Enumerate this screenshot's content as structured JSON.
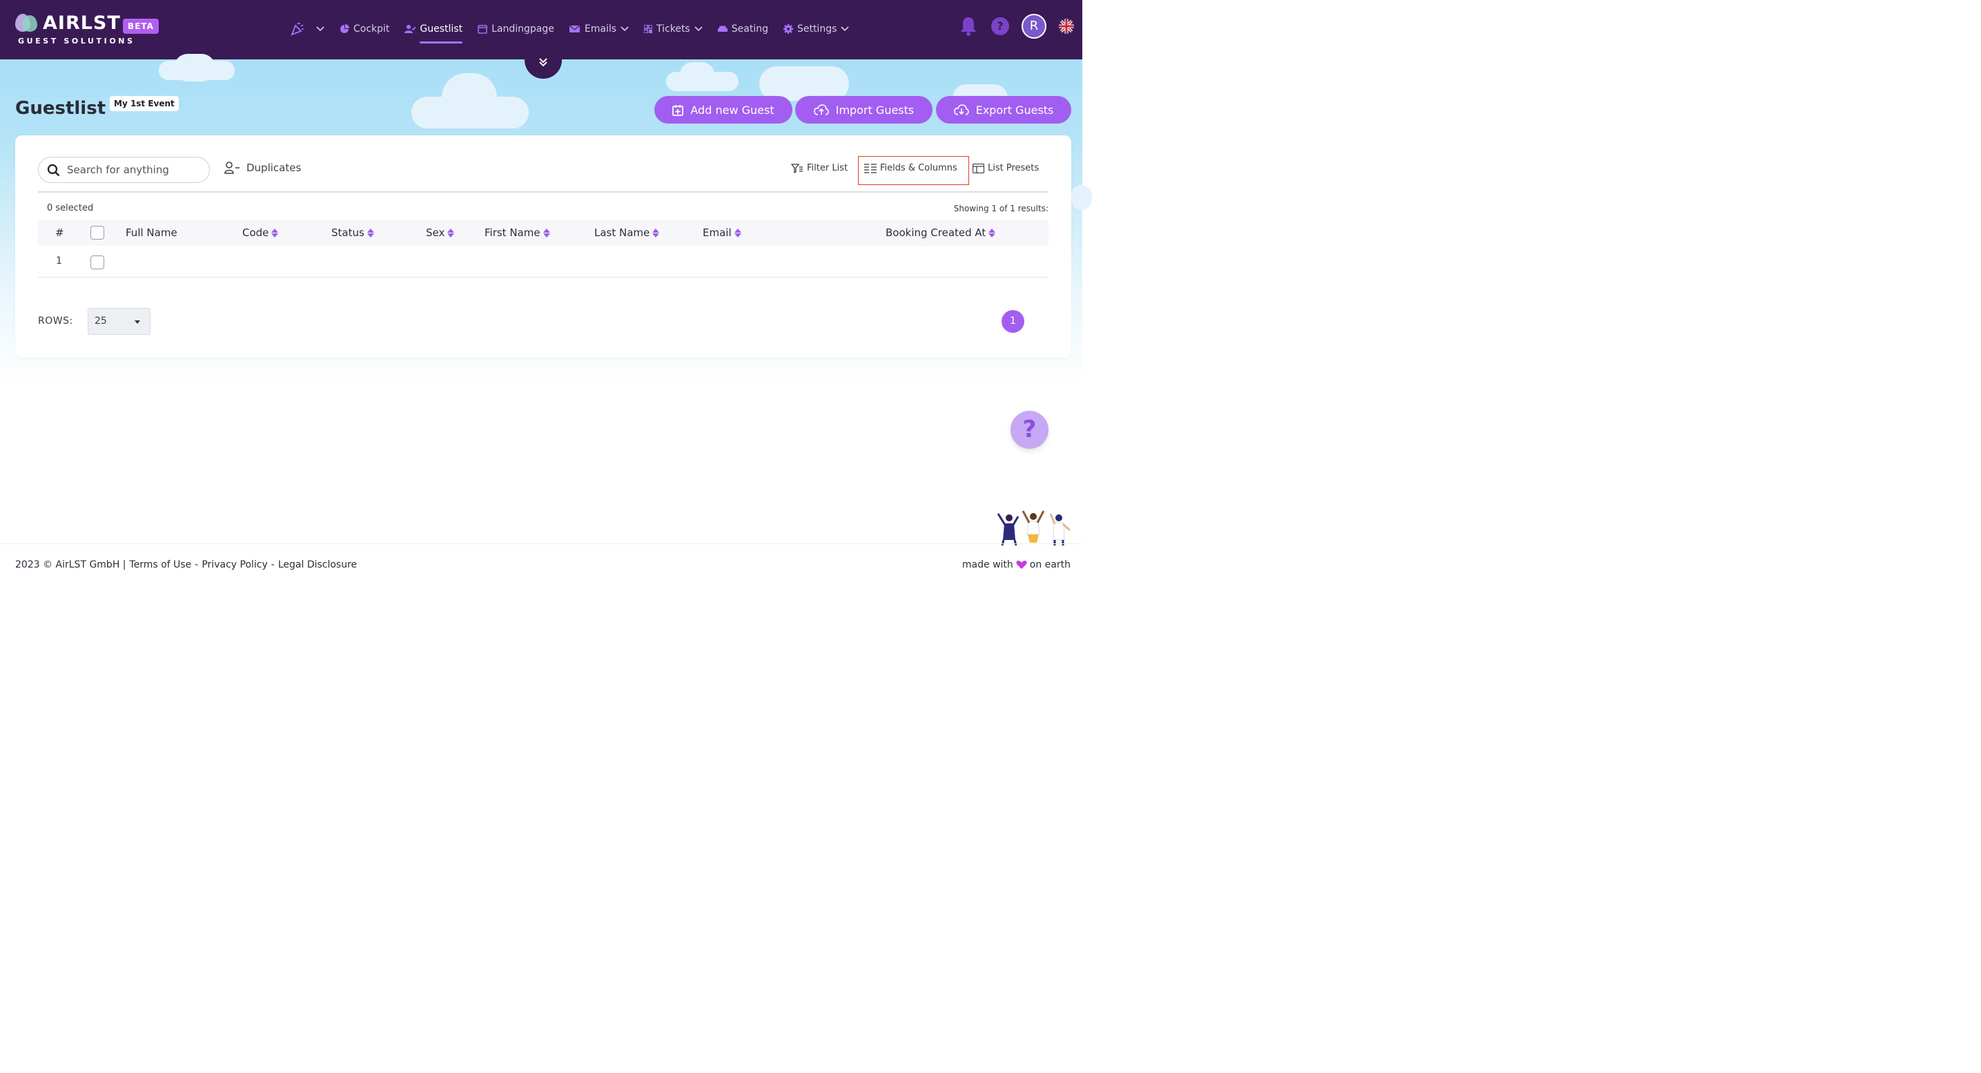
{
  "app": {
    "logo_text": "AIRLST",
    "logo_subtitle": "GUEST SOLUTIONS",
    "badge": "BETA"
  },
  "nav": {
    "items": [
      {
        "label": "",
        "icon": "party-popper-icon",
        "has_dropdown": true
      },
      {
        "label": "Cockpit",
        "icon": "pie-chart-icon"
      },
      {
        "label": "Guestlist",
        "icon": "user-check-icon",
        "active": true
      },
      {
        "label": "Landingpage",
        "icon": "window-icon"
      },
      {
        "label": "Emails",
        "icon": "mail-icon",
        "has_dropdown": true
      },
      {
        "label": "Tickets",
        "icon": "qr-code-icon",
        "has_dropdown": true
      },
      {
        "label": "Seating",
        "icon": "sofa-icon"
      },
      {
        "label": "Settings",
        "icon": "gear-icon",
        "has_dropdown": true
      }
    ],
    "help_glyph": "?",
    "avatar_initial": "R",
    "language": "English (UK flag)"
  },
  "page": {
    "title": "Guestlist",
    "event_badge": "My 1st Event"
  },
  "actions": {
    "add_guest": "Add new Guest",
    "import_guests": "Import Guests",
    "export_guests": "Export Guests"
  },
  "toolbar": {
    "search_placeholder": "Search for anything",
    "duplicates": "Duplicates",
    "filter_list": "Filter List",
    "fields_columns": "Fields & Columns",
    "list_presets": "List Presets"
  },
  "table": {
    "selected_text": "0 selected",
    "showing_text": "Showing 1 of 1 results:",
    "columns": {
      "hash": "#",
      "full_name": "Full Name",
      "code": "Code",
      "status": "Status",
      "sex": "Sex",
      "first_name": "First Name",
      "last_name": "Last Name",
      "email": "Email",
      "booking_created_at": "Booking Created At"
    },
    "rows": [
      {
        "number": "1",
        "checked": false
      }
    ]
  },
  "pagination": {
    "rows_label": "ROWS:",
    "rows_value": "25",
    "current_page": "1"
  },
  "help_float": "?",
  "footer": {
    "copyright": "2023 © AirLST GmbH |",
    "terms": "Terms of Use",
    "sep1": "-",
    "privacy": "Privacy Policy",
    "sep2": "-",
    "legal": "Legal Disclosure",
    "made_with": "made with",
    "on_earth": "on earth"
  },
  "colors": {
    "header_bg": "#3a1a55",
    "accent": "#a25ef0",
    "highlight_border": "#e53b2a"
  }
}
